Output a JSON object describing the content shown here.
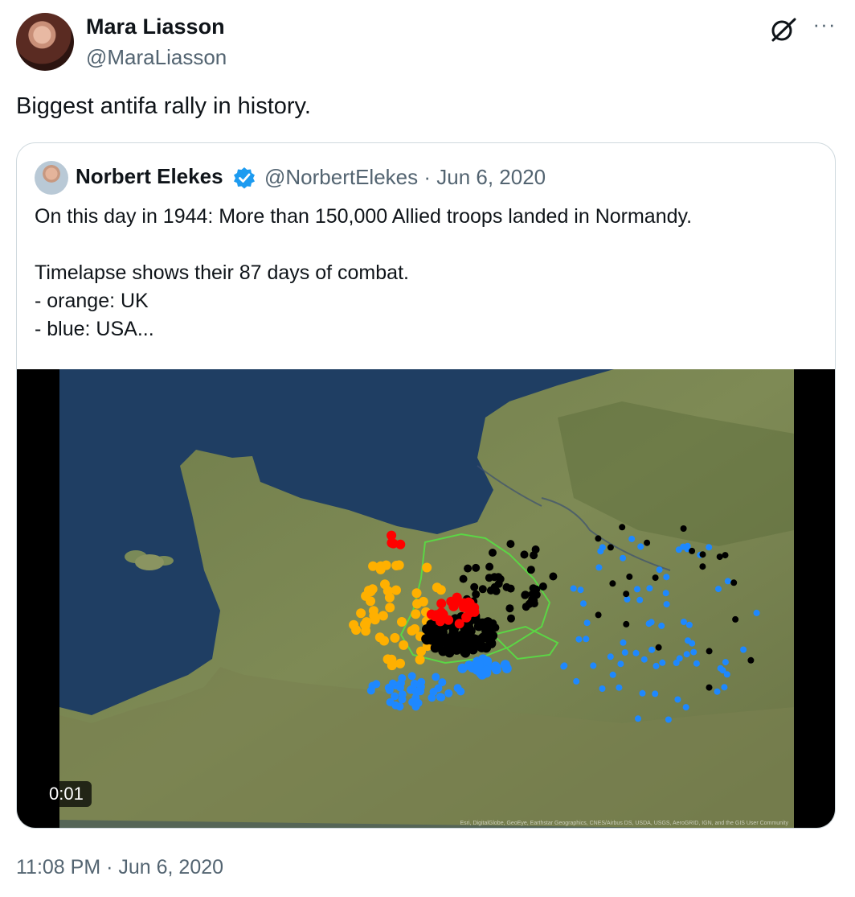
{
  "tweet": {
    "author_name": "Mara Liasson",
    "author_handle": "@MaraLiasson",
    "text": "Biggest antifa rally in history.",
    "timestamp": "11:08 PM · Jun 6, 2020",
    "more_label": "···"
  },
  "quoted": {
    "author_name": "Norbert Elekes",
    "author_handle": "@NorbertElekes · Jun 6, 2020",
    "body": "On this day in 1944: More than 150,000 Allied troops landed in Normandy.\n\nTimelapse shows their 87 days of combat.\n- orange: UK\n- blue: USA...",
    "video": {
      "time": "0:01",
      "credits": "Esri, DigitalGlobe, GeoEye, Earthstar Geographics, CNES/Airbus DS, USDA, USGS, AeroGRID, IGN, and the GIS User Community"
    }
  },
  "icons": {
    "grok": "grok-icon",
    "more": "more-icon",
    "verified": "verified-badge-icon"
  },
  "colors": {
    "uk_orange": "#ffb000",
    "usa_blue": "#1e88ff",
    "red": "#ff0000",
    "black": "#000000",
    "verified_blue": "#1d9bf0"
  }
}
